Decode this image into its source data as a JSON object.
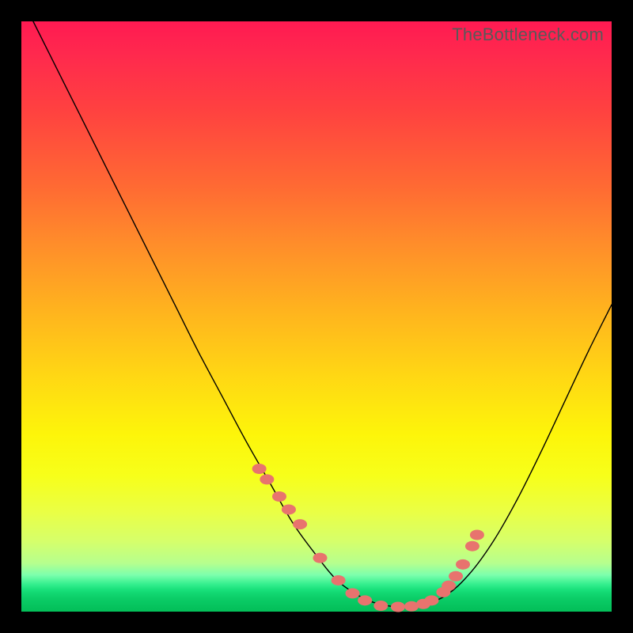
{
  "watermark": "TheBottleneck.com",
  "chart_data": {
    "type": "line",
    "title": "",
    "xlabel": "",
    "ylabel": "",
    "xlim": [
      0,
      100
    ],
    "ylim": [
      0,
      100
    ],
    "grid": false,
    "legend": false,
    "background_gradient": {
      "orientation": "vertical",
      "stops": [
        {
          "pos": 0,
          "color": "#ff1a52"
        },
        {
          "pos": 0.5,
          "color": "#ffc31a"
        },
        {
          "pos": 0.78,
          "color": "#f7ff2a"
        },
        {
          "pos": 0.93,
          "color": "#7cffad"
        },
        {
          "pos": 1.0,
          "color": "#03bf59"
        }
      ]
    },
    "series": [
      {
        "name": "bottleneck-curve",
        "x": [
          2,
          6,
          10,
          14,
          18,
          22,
          26,
          30,
          34,
          38,
          42,
          46,
          50,
          53,
          56,
          59,
          62,
          65,
          68,
          72,
          76,
          80,
          84,
          88,
          92,
          96,
          100
        ],
        "y": [
          100,
          92,
          84,
          76,
          68,
          60,
          52,
          44,
          36.5,
          29,
          22,
          15,
          9.5,
          5.8,
          3.4,
          1.8,
          1.0,
          0.8,
          1.2,
          2.8,
          6.5,
          12,
          19,
          27,
          35.5,
          44,
          52
        ],
        "note": "y is relative height from the green floor (0) to the red top (100); minimum near x≈65"
      }
    ],
    "markers": {
      "name": "salmon-dots",
      "color": "#e8736e",
      "approx_size_px": 13,
      "x": [
        40.3,
        41.6,
        43.7,
        45.3,
        47.2,
        50.6,
        53.7,
        56.1,
        58.2,
        60.9,
        63.8,
        66.1,
        68.1,
        69.5,
        71.5,
        72.4,
        73.6,
        74.8,
        76.4,
        77.2
      ],
      "y": [
        24.2,
        22.4,
        19.5,
        17.3,
        14.8,
        9.1,
        5.3,
        3.1,
        1.9,
        1.0,
        0.8,
        0.9,
        1.3,
        1.9,
        3.3,
        4.4,
        6.0,
        8.0,
        11.1,
        13.0
      ]
    }
  }
}
